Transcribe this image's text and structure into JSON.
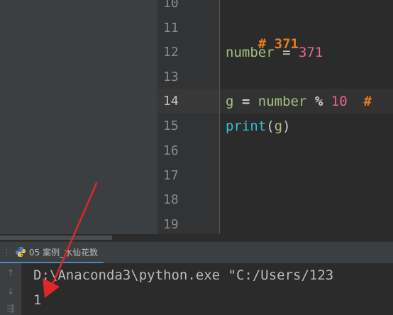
{
  "gutter": {
    "line_numbers": [
      "10",
      "11",
      "12",
      "13",
      "14",
      "15",
      "16",
      "17",
      "18",
      "19"
    ],
    "current_line": "14"
  },
  "code": {
    "line11_comment": "# 371",
    "line12_var": "number",
    "line12_eq": " = ",
    "line12_num": "371",
    "line14_var": "g",
    "line14_eq": " = ",
    "line14_ident": "number",
    "line14_op": " % ",
    "line14_num": "10",
    "line14_comment": "  #",
    "line15_builtin": "print",
    "line15_open": "(",
    "line15_arg": "g",
    "line15_close": ")"
  },
  "run_panel": {
    "tab_label": "05 案例_水仙花数",
    "command_line": "D:\\Anaconda3\\python.exe \"C:/Users/123",
    "output_line": "1"
  },
  "icons": {
    "tab_icon": "python-icon",
    "up_icon": "arrow-up-icon",
    "down_icon": "arrow-down-icon",
    "wrap_icon": "soft-wrap-icon",
    "annotation": "red-arrow-annotation"
  },
  "colors": {
    "comment": "#e87c1a",
    "number": "#e0698f",
    "identifier": "#a7c080",
    "builtin": "#2fc4d9",
    "annotation_red": "#e0262a"
  }
}
